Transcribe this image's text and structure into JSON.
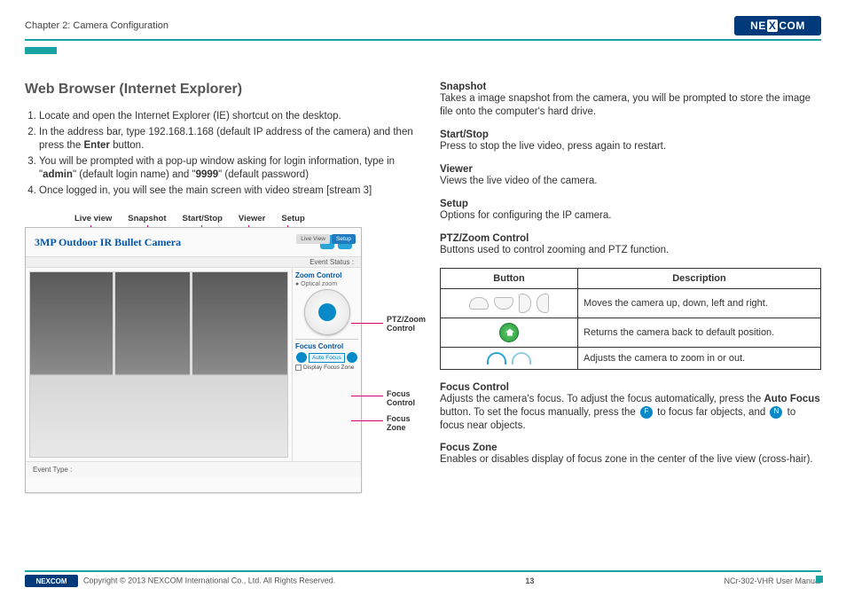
{
  "header": {
    "chapter": "Chapter 2: Camera Configuration",
    "logo_text": "NEXCOM"
  },
  "left": {
    "title": "Web Browser (Internet Explorer)",
    "steps": [
      "Locate and open the Internet Explorer (IE) shortcut on the desktop.",
      "In the address bar, type 192.168.1.168 (default IP address of the camera) and then press the <b>Enter</b> button.",
      "You will be prompted with a pop-up window asking for login information, type in \"<b>admin</b>\" (default login name) and \"<b>9999</b>\" (default password)",
      "Once logged in, you will see the main screen with video stream [stream 3]"
    ],
    "labels": [
      "Live view",
      "Snapshot",
      "Start/Stop",
      "Viewer",
      "Setup"
    ],
    "screenshot": {
      "title": "3MP Outdoor IR Bullet Camera",
      "event_status": "Event Status :",
      "zoom_title": "Zoom Control",
      "optical": "● Optical zoom",
      "focus_title": "Focus Control",
      "autofocus": "Auto Focus",
      "display_fz": "Display Focus Zone",
      "footer": "Event Type :",
      "live_view_btn": "Live View",
      "setup_btn": "Setup"
    },
    "annotations": {
      "ptz": "PTZ/Zoom Control",
      "focus_ctrl": "Focus Control",
      "focus_zone": "Focus Zone"
    }
  },
  "right": {
    "snapshot_t": "Snapshot",
    "snapshot_d": "Takes a image snapshot from the camera, you will be prompted to store the image file onto the computer's hard drive.",
    "startstop_t": "Start/Stop",
    "startstop_d": "Press to stop the live video, press again to restart.",
    "viewer_t": "Viewer",
    "viewer_d": "Views the live video of the camera.",
    "setup_t": "Setup",
    "setup_d": "Options for configuring the IP camera.",
    "ptz_t": "PTZ/Zoom Control",
    "ptz_d": "Buttons used to control zooming and PTZ function.",
    "table": {
      "th1": "Button",
      "th2": "Description",
      "r1": "Moves the camera up, down, left and right.",
      "r2": "Returns the camera back to default position.",
      "r3": "Adjusts the camera to zoom in or out."
    },
    "focusctrl_t": "Focus Control",
    "focusctrl_d1": "Adjusts the camera's focus. To adjust the focus automatically, press the ",
    "focusctrl_auto": "Auto Focus",
    "focusctrl_d2": " button. To set the focus manually, press the ",
    "focusctrl_d3": " to focus far objects, and ",
    "focusctrl_d4": " to focus near objects.",
    "focuszone_t": "Focus Zone",
    "focuszone_d": "Enables or disables display of focus zone in the center of the live view (cross-hair)."
  },
  "footer": {
    "copyright": "Copyright © 2013 NEXCOM International Co., Ltd. All Rights Reserved.",
    "page": "13",
    "doc": "NCr-302-VHR User Manual"
  }
}
